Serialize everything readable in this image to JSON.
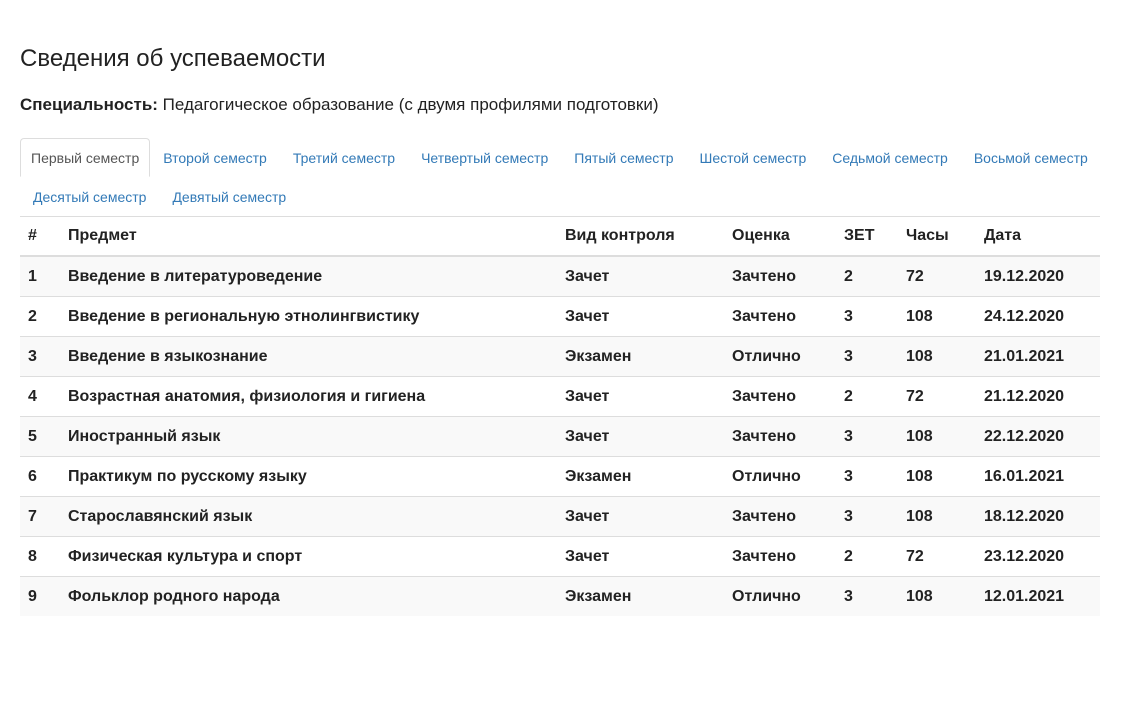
{
  "page": {
    "title": "Сведения об успеваемости",
    "specialty_label": "Специальность:",
    "specialty_value": "Педагогическое образование (с двумя профилями подготовки)"
  },
  "tabs": [
    {
      "label": "Первый семестр",
      "active": true
    },
    {
      "label": "Второй семестр",
      "active": false
    },
    {
      "label": "Третий семестр",
      "active": false
    },
    {
      "label": "Четвертый семестр",
      "active": false
    },
    {
      "label": "Пятый семестр",
      "active": false
    },
    {
      "label": "Шестой семестр",
      "active": false
    },
    {
      "label": "Седьмой семестр",
      "active": false
    },
    {
      "label": "Восьмой семестр",
      "active": false
    },
    {
      "label": "Десятый семестр",
      "active": false
    },
    {
      "label": "Девятый семестр",
      "active": false
    }
  ],
  "table": {
    "headers": {
      "num": "#",
      "subject": "Предмет",
      "control": "Вид контроля",
      "grade": "Оценка",
      "zet": "ЗЕТ",
      "hours": "Часы",
      "date": "Дата"
    },
    "rows": [
      {
        "num": "1",
        "subject": "Введение в литературоведение",
        "control": "Зачет",
        "grade": "Зачтено",
        "zet": "2",
        "hours": "72",
        "date": "19.12.2020"
      },
      {
        "num": "2",
        "subject": "Введение в региональную этнолингвистику",
        "control": "Зачет",
        "grade": "Зачтено",
        "zet": "3",
        "hours": "108",
        "date": "24.12.2020"
      },
      {
        "num": "3",
        "subject": "Введение в языкознание",
        "control": "Экзамен",
        "grade": "Отлично",
        "zet": "3",
        "hours": "108",
        "date": "21.01.2021"
      },
      {
        "num": "4",
        "subject": "Возрастная анатомия, физиология и гигиена",
        "control": "Зачет",
        "grade": "Зачтено",
        "zet": "2",
        "hours": "72",
        "date": "21.12.2020"
      },
      {
        "num": "5",
        "subject": "Иностранный язык",
        "control": "Зачет",
        "grade": "Зачтено",
        "zet": "3",
        "hours": "108",
        "date": "22.12.2020"
      },
      {
        "num": "6",
        "subject": "Практикум по русскому языку",
        "control": "Экзамен",
        "grade": "Отлично",
        "zet": "3",
        "hours": "108",
        "date": "16.01.2021"
      },
      {
        "num": "7",
        "subject": "Старославянский язык",
        "control": "Зачет",
        "grade": "Зачтено",
        "zet": "3",
        "hours": "108",
        "date": "18.12.2020"
      },
      {
        "num": "8",
        "subject": "Физическая культура и спорт",
        "control": "Зачет",
        "grade": "Зачтено",
        "zet": "2",
        "hours": "72",
        "date": "23.12.2020"
      },
      {
        "num": "9",
        "subject": "Фольклор родного народа",
        "control": "Экзамен",
        "grade": "Отлично",
        "zet": "3",
        "hours": "108",
        "date": "12.01.2021"
      }
    ]
  },
  "colors": {
    "link": "#337ab7",
    "border": "#dddddd",
    "stripe": "#f9f9f9"
  }
}
